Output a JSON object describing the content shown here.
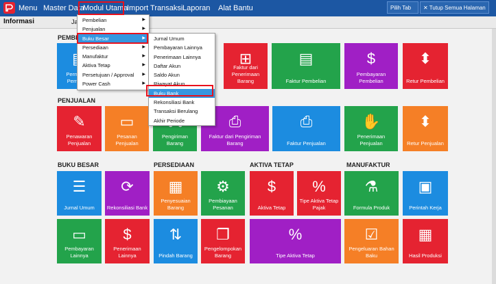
{
  "topbar": {
    "menu_label": "Menu",
    "items": [
      "Master Data",
      "Modul Utama",
      "Import Transaksi",
      "Laporan",
      "Alat Bantu"
    ],
    "pilih_tab": "Pilih Tab",
    "tutup_semua": "Tutup Semua Halaman"
  },
  "tab": {
    "label": "Informasi",
    "partial": "Ja"
  },
  "sections": {
    "pembelian": "PEMBELIAN",
    "penjualan": "PENJUALAN",
    "buku_besar": "BUKU BESAR",
    "persediaan": "PERSEDIAAN",
    "aktiva_tetap": "AKTIVA TETAP",
    "manufaktur": "MANUFAKTUR"
  },
  "tiles": {
    "permintaan_pembelian": "Permintaan Pembelian",
    "faktur_penerimaan": "Faktur dari Penerimaan Barang",
    "faktur_pembelian": "Faktur Pembelian",
    "pembayaran_pembelian": "Pembayaran Pembelian",
    "retur_pembelian": "Retur Pembelian",
    "penawaran_penjualan": "Penawaran Penjualan",
    "pesanan_penjualan": "Pesanan Penjualan",
    "pengiriman_barang": "Pengiriman Barang",
    "faktur_pengiriman": "Faktur dari Pengiriman Barang",
    "faktur_penjualan": "Faktur Penjualan",
    "penerimaan_penjualan": "Penerimaan Penjualan",
    "retur_penjualan": "Retur Penjualan",
    "jurnal_umum": "Jurnal Umum",
    "rekonsiliasi_bank": "Rekonsiliasi Bank",
    "penyesuaian_barang": "Penyesuaian Barang",
    "pembiayaan_pesanan": "Pembiayaan Pesanan",
    "aktiva_tetap": "Aktiva Tetap",
    "tipe_aktiva_pajak": "Tipe Aktiva Tetap Pajak",
    "formula_produk": "Formula Produk",
    "perintah_kerja": "Perintah Kerja",
    "pembayaran_lainnya": "Pembayaran Lainnya",
    "penerimaan_lainnya": "Penerimaan Lainnya",
    "pindah_barang": "Pindah Barang",
    "pengelompokan_barang": "Pengelompokan Barang",
    "tipe_aktiva_tetap": "Tipe Aktiva Tetap",
    "pengeluaran_bahan_baku": "Pengeluaran Bahan Baku",
    "hasil_produksi": "Hasil Produksi"
  },
  "menu1": [
    "Pembelian",
    "Penjualan",
    "Buku Besar",
    "Persediaan",
    "Manufaktur",
    "Aktiva Tetap",
    "Persetujuan / Approval",
    "Power Cash"
  ],
  "menu2": [
    "Jurnal Umum",
    "Pembayaran Lainnya",
    "Penerimaan Lainnya",
    "Daftar Akun",
    "Saldo Akun",
    "Riwayat Akun",
    "Buku Bank",
    "Rekonsiliasi Bank",
    "Transaksi Berulang",
    "Akhir Periode"
  ],
  "colors": {
    "topbar": "#1c57a3",
    "red": "#e52331",
    "orange": "#f57f26",
    "green": "#23a34b",
    "purple": "#a01fc5",
    "blue": "#1c8ce0",
    "highlight": "#3597e0",
    "annotation": "#e8101c"
  }
}
